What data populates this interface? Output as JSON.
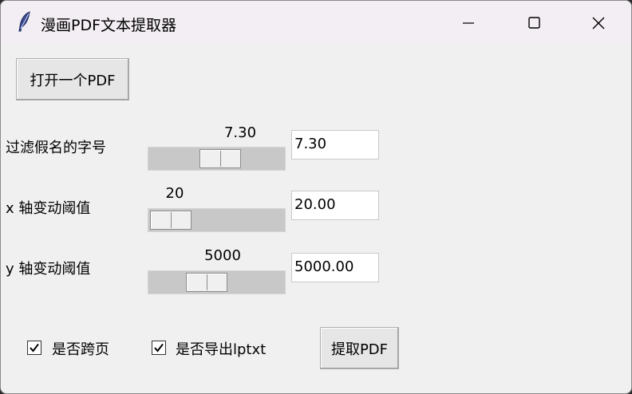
{
  "window": {
    "title": "漫画PDF文本提取器",
    "icon": "feather-icon",
    "controls": [
      "minimize-icon",
      "maximize-icon",
      "close-icon"
    ]
  },
  "open_button": {
    "label": "打开一个PDF"
  },
  "sliders": [
    {
      "label": "过滤假名的字号",
      "value_label": "7.30",
      "entry_value": "7.30",
      "position_fraction": 0.54
    },
    {
      "label": "x 轴变动阈值",
      "value_label": "20",
      "entry_value": "20.00",
      "position_fraction": 0.0
    },
    {
      "label": "y 轴变动阈值",
      "value_label": "5000",
      "entry_value": "5000.00",
      "position_fraction": 0.39
    }
  ],
  "checkboxes": [
    {
      "label": "是否跨页",
      "checked": true
    },
    {
      "label": "是否导出lptxt",
      "checked": true
    }
  ],
  "extract_button": {
    "label": "提取PDF"
  }
}
